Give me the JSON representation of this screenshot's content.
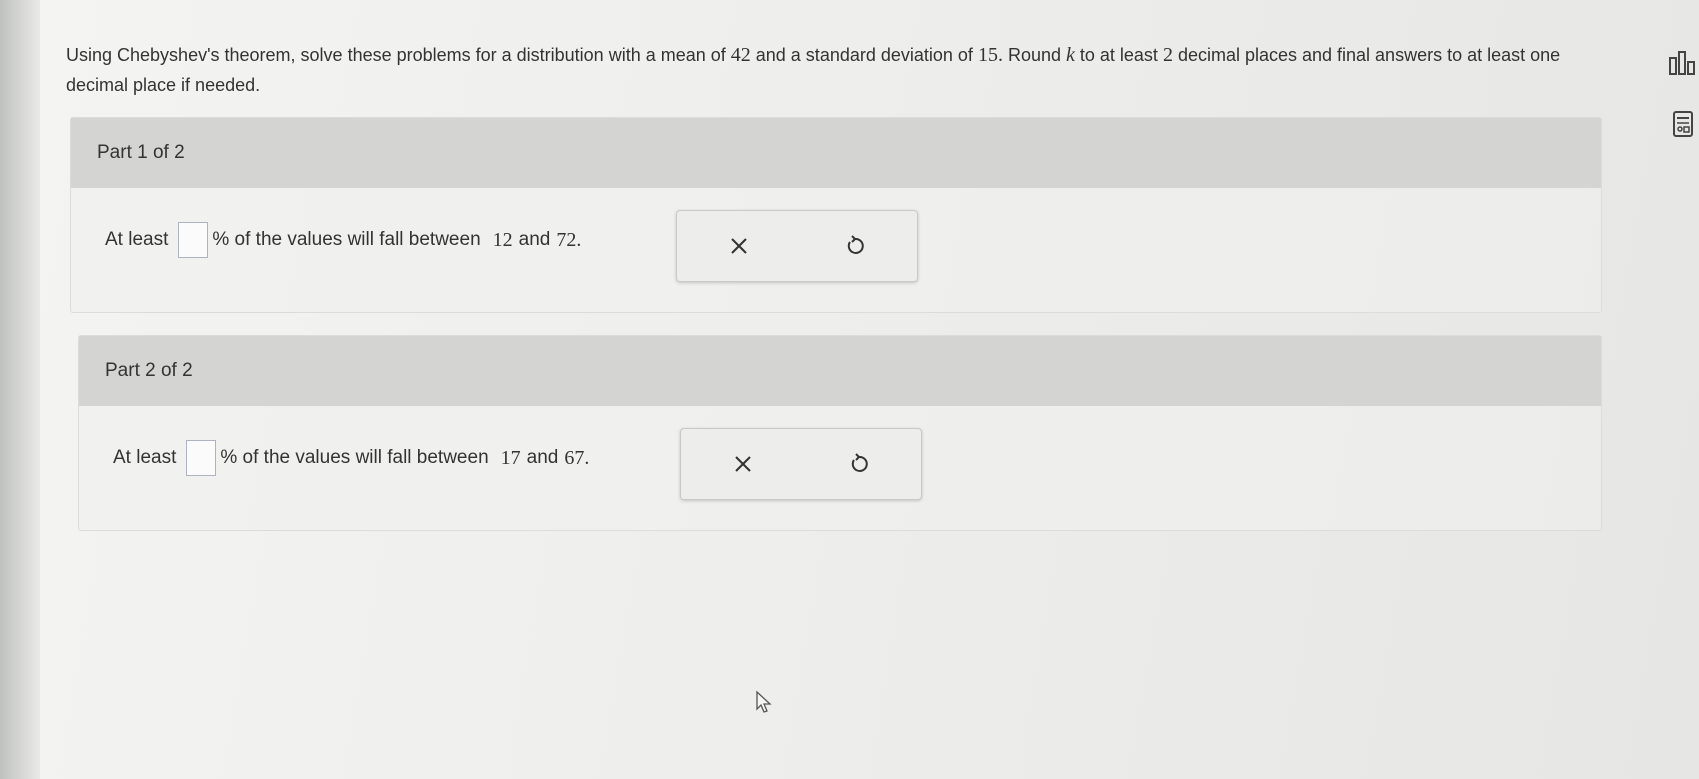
{
  "question": {
    "parts": [
      {
        "t": "Using Chebyshev's theorem, solve these problems for a distribution with a mean of "
      },
      {
        "n": "42"
      },
      {
        "t": " and a standard deviation of "
      },
      {
        "n": "15."
      },
      {
        "t": " Round "
      },
      {
        "v": "k"
      },
      {
        "t": " to at least "
      },
      {
        "n": "2"
      },
      {
        "t": " decimal places and final answers to at least one decimal place if needed."
      }
    ]
  },
  "part1": {
    "title": "Part 1 of 2",
    "prefix": "At least",
    "answer_value": "",
    "suffix": "% of the values will fall between",
    "low": "12",
    "and_word": "and",
    "high": "72."
  },
  "part2": {
    "title": "Part 2 of 2",
    "prefix": "At least",
    "answer_value": "",
    "suffix": "% of the values will fall between",
    "low": "17",
    "and_word": "and",
    "high": "67."
  },
  "icons": {
    "clear": "x-icon",
    "undo": "undo-icon",
    "chart_tool": "bar-chart-icon",
    "calculator_tool": "calculator-icon"
  },
  "colors": {
    "header_bg": "#d4d5d3",
    "answer_border": "#aeb4bf",
    "text": "#333333"
  }
}
